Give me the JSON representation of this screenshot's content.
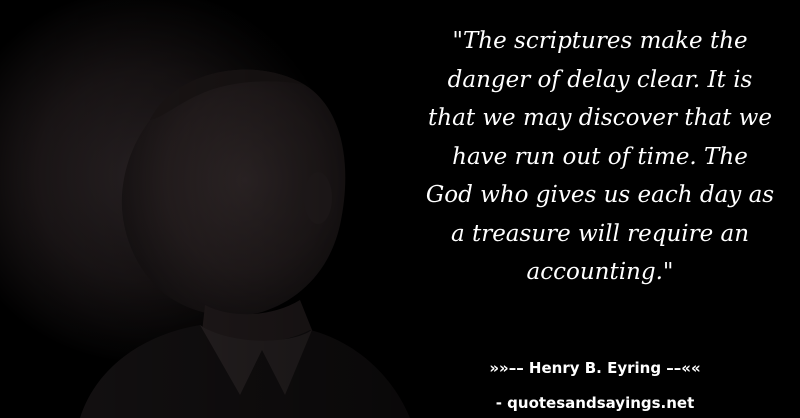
{
  "quote": {
    "lines": [
      "\"The scriptures make the",
      "danger of delay clear. It is",
      "that we may discover that we",
      "have run out of time. The",
      "God who gives us each day as",
      "a treasure will require an",
      "accounting.\""
    ]
  },
  "attribution": {
    "author": "»»–– Henry B. Eyring ––««",
    "source": "- quotesandsayings.net"
  },
  "colors": {
    "background": "#000000",
    "text": "#ffffff"
  }
}
